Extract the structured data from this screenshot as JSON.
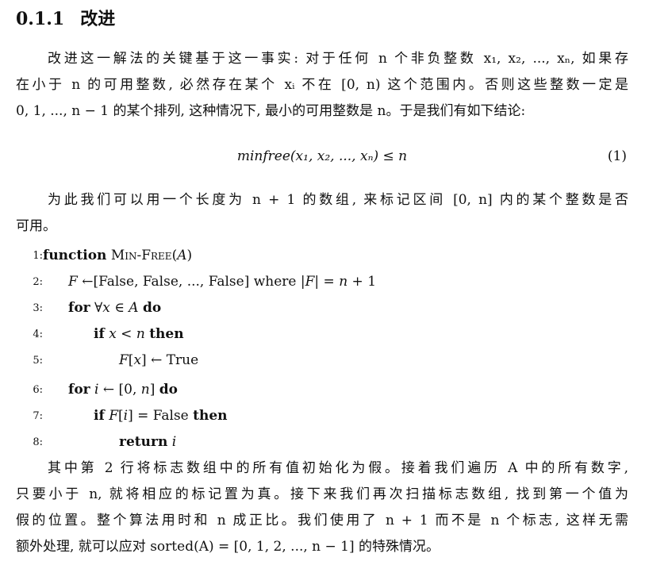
{
  "section": {
    "number": "0.1.1",
    "title": "改进"
  },
  "paragraph1": {
    "lines": [
      "改进这一解法的关键基于这一事实: 对于任何 n 个非负整数 x₁, x₂, ..., xₙ, 如果存",
      "在小于 n 的可用整数, 必然存在某个 xᵢ 不在 [0, n) 这个范围内。否则这些整数一定是",
      "0, 1, ..., n − 1 的某个排列, 这种情况下, 最小的可用整数是 n。于是我们有如下结论:"
    ]
  },
  "equation": {
    "body": "minfree(x₁, x₂, ..., xₙ) ≤ n",
    "number": "(1)"
  },
  "paragraph2": {
    "lines": [
      "为此我们可以用一个长度为 n + 1 的数组, 来标记区间 [0, n] 内的某个整数是否",
      "可用。"
    ]
  },
  "algorithm": {
    "lines": [
      {
        "num": "1:",
        "indent": 0,
        "parts": [
          {
            "t": "function",
            "s": "kw"
          },
          {
            "t": " ",
            "s": ""
          },
          {
            "t": "Min-Free",
            "s": "sc"
          },
          {
            "t": "(",
            "s": ""
          },
          {
            "t": "A",
            "s": "m"
          },
          {
            "t": ")",
            "s": ""
          }
        ]
      },
      {
        "num": "2:",
        "indent": 1,
        "parts": [
          {
            "t": "F",
            "s": "m"
          },
          {
            "t": " ←[False, False, ..., False] where |",
            "s": ""
          },
          {
            "t": "F",
            "s": "m"
          },
          {
            "t": "| = ",
            "s": ""
          },
          {
            "t": "n",
            "s": "m"
          },
          {
            "t": " + 1",
            "s": ""
          }
        ]
      },
      {
        "num": "3:",
        "indent": 1,
        "parts": [
          {
            "t": "for",
            "s": "kw"
          },
          {
            "t": " ∀",
            "s": ""
          },
          {
            "t": "x",
            "s": "m"
          },
          {
            "t": " ∈ ",
            "s": ""
          },
          {
            "t": "A",
            "s": "m"
          },
          {
            "t": " ",
            "s": ""
          },
          {
            "t": "do",
            "s": "kw"
          }
        ]
      },
      {
        "num": "4:",
        "indent": 2,
        "parts": [
          {
            "t": "if",
            "s": "kw"
          },
          {
            "t": " ",
            "s": ""
          },
          {
            "t": "x",
            "s": "m"
          },
          {
            "t": " < ",
            "s": ""
          },
          {
            "t": "n",
            "s": "m"
          },
          {
            "t": " ",
            "s": ""
          },
          {
            "t": "then",
            "s": "kw"
          }
        ]
      },
      {
        "num": "5:",
        "indent": 3,
        "parts": [
          {
            "t": "F",
            "s": "m"
          },
          {
            "t": "[",
            "s": ""
          },
          {
            "t": "x",
            "s": "m"
          },
          {
            "t": "] ← True",
            "s": ""
          }
        ]
      },
      {
        "num": "6:",
        "indent": 1,
        "parts": [
          {
            "t": "for",
            "s": "kw"
          },
          {
            "t": " ",
            "s": ""
          },
          {
            "t": "i",
            "s": "m"
          },
          {
            "t": " ← [0, ",
            "s": ""
          },
          {
            "t": "n",
            "s": "m"
          },
          {
            "t": "] ",
            "s": ""
          },
          {
            "t": "do",
            "s": "kw"
          }
        ]
      },
      {
        "num": "7:",
        "indent": 2,
        "parts": [
          {
            "t": "if",
            "s": "kw"
          },
          {
            "t": " ",
            "s": ""
          },
          {
            "t": "F",
            "s": "m"
          },
          {
            "t": "[",
            "s": ""
          },
          {
            "t": "i",
            "s": "m"
          },
          {
            "t": "] = False ",
            "s": ""
          },
          {
            "t": "then",
            "s": "kw"
          }
        ]
      },
      {
        "num": "8:",
        "indent": 3,
        "parts": [
          {
            "t": "return",
            "s": "kw"
          },
          {
            "t": " ",
            "s": ""
          },
          {
            "t": "i",
            "s": "m"
          }
        ]
      }
    ]
  },
  "paragraph3": {
    "lines": [
      "其中第 2 行将标志数组中的所有值初始化为假。接着我们遍历 A 中的所有数字,",
      "只要小于 n, 就将相应的标记置为真。接下来我们再次扫描标志数组, 找到第一个值为",
      "假的位置。整个算法用时和 n 成正比。我们使用了 n + 1 而不是 n 个标志, 这样无需",
      "额外处理, 就可以应对 sorted(A) = [0, 1, 2, ..., n − 1] 的特殊情况。"
    ]
  }
}
